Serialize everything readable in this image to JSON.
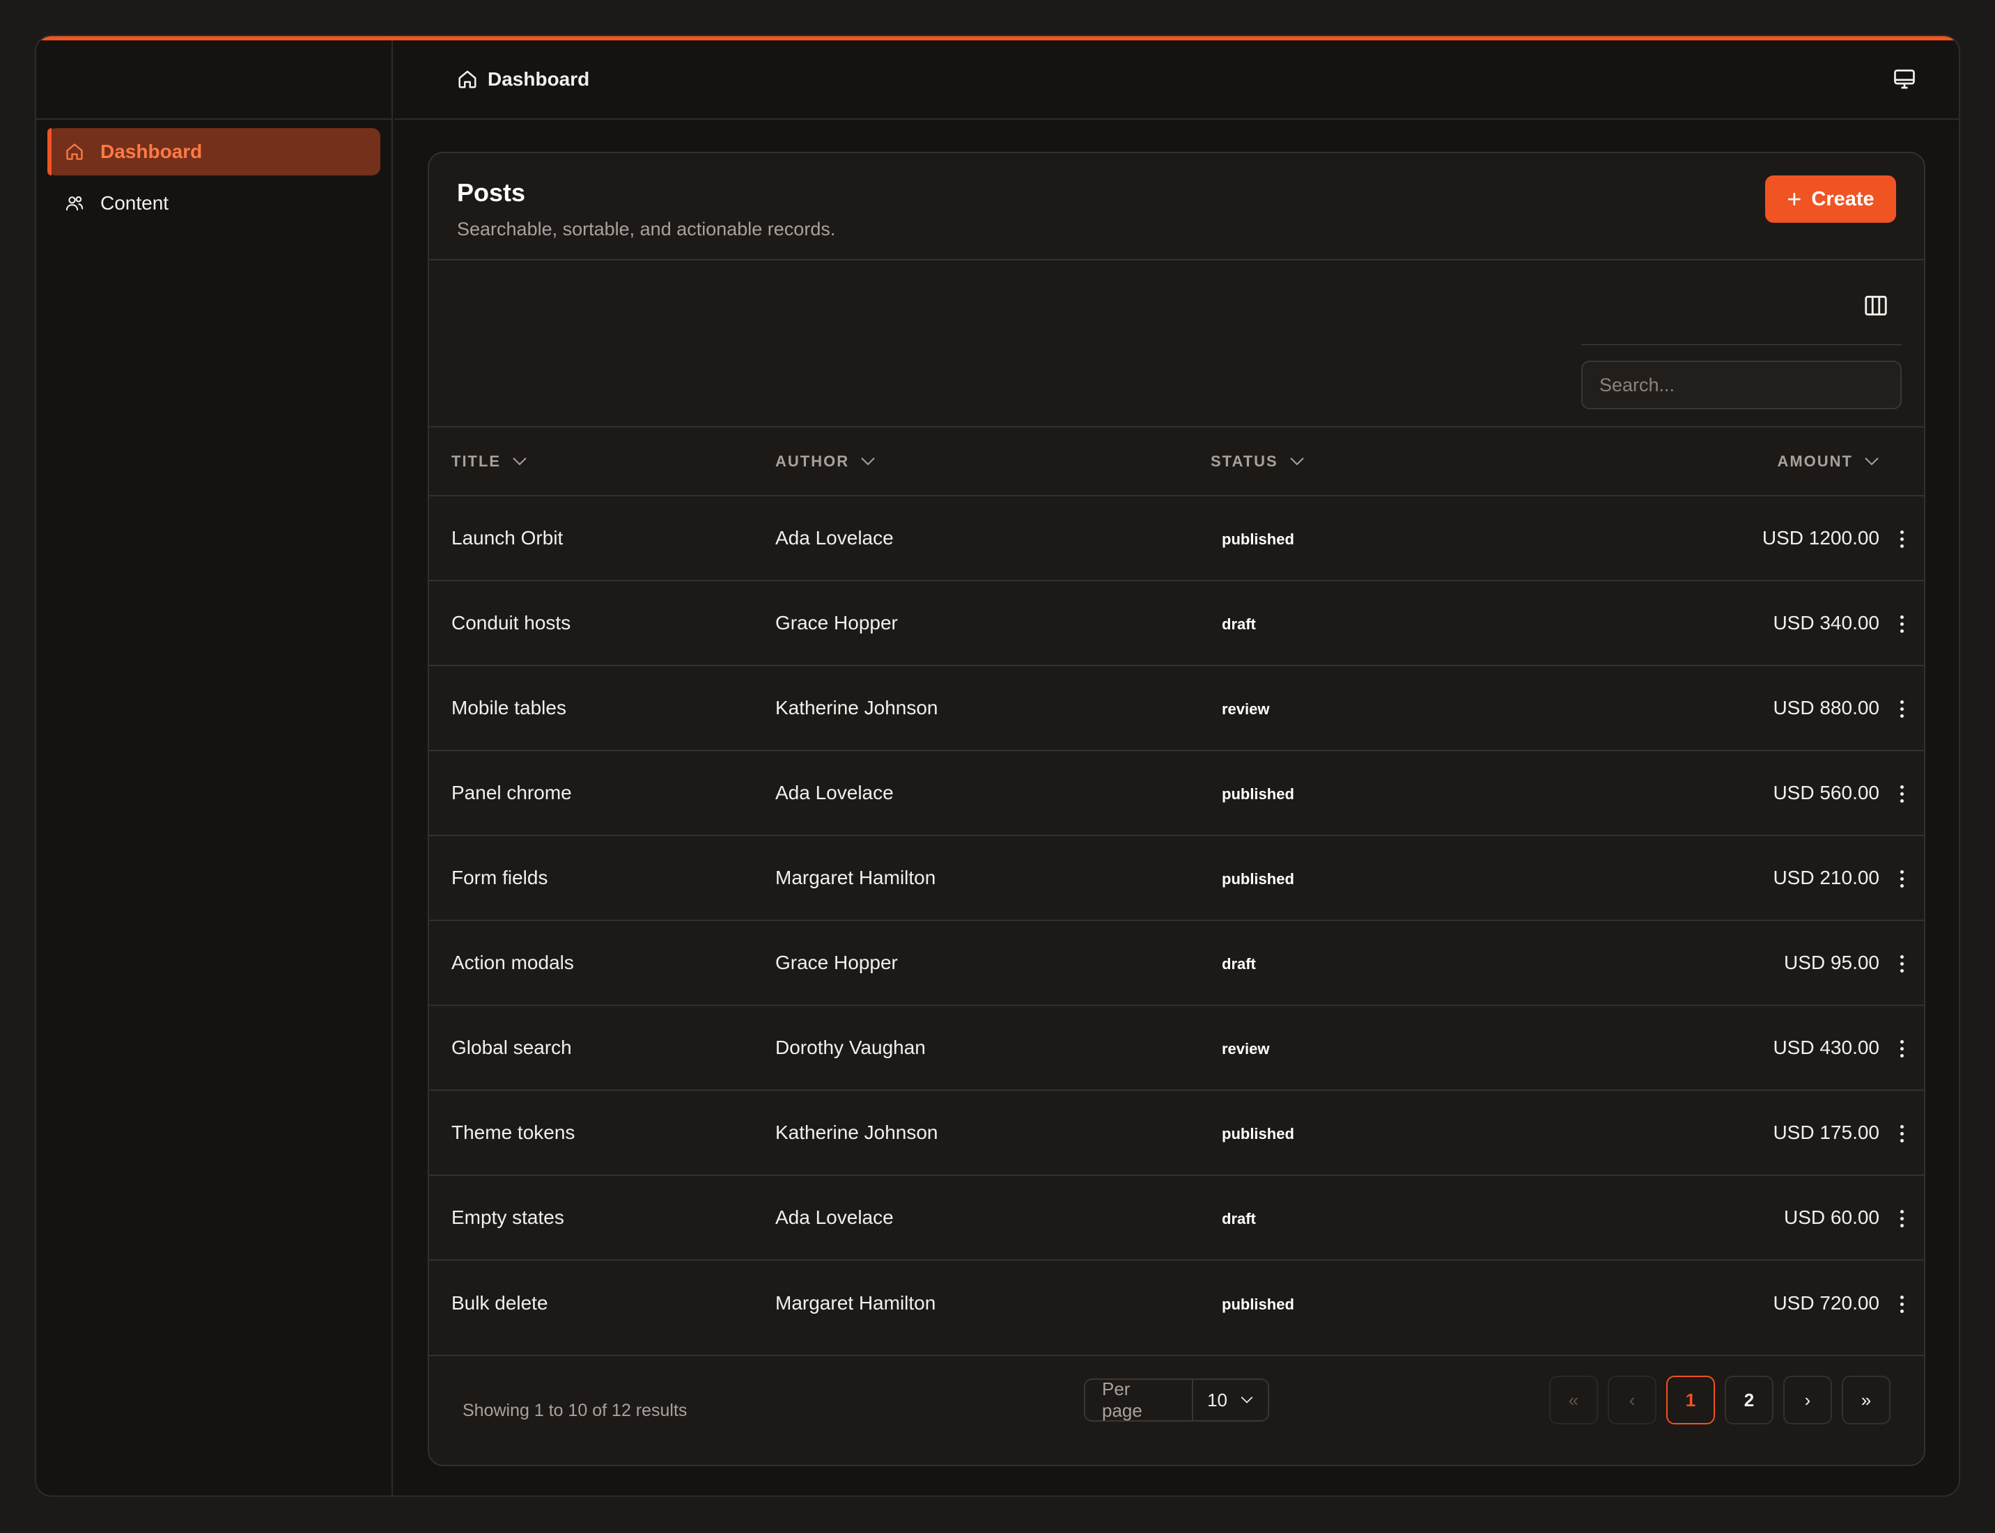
{
  "colors": {
    "accent": "#f05423",
    "background": "#151312",
    "card": "#1c1917",
    "border": "#33302d"
  },
  "sidebar": {
    "items": [
      {
        "label": "Dashboard",
        "icon": "home-icon",
        "active": true
      },
      {
        "label": "Content",
        "icon": "users-icon",
        "active": false
      }
    ]
  },
  "header": {
    "breadcrumb": "Dashboard",
    "monitor_icon": "monitor-icon"
  },
  "card": {
    "title": "Posts",
    "subtitle": "Searchable, sortable, and actionable records.",
    "create_label": "Create"
  },
  "search": {
    "placeholder": "Search..."
  },
  "table": {
    "headers": {
      "title": "TITLE",
      "author": "AUTHOR",
      "status": "STATUS",
      "amount": "AMOUNT"
    },
    "rows": [
      {
        "title": "Launch Orbit",
        "author": "Ada Lovelace",
        "status": "published",
        "amount": "USD 1200.00"
      },
      {
        "title": "Conduit hosts",
        "author": "Grace Hopper",
        "status": "draft",
        "amount": "USD 340.00"
      },
      {
        "title": "Mobile tables",
        "author": "Katherine Johnson",
        "status": "review",
        "amount": "USD 880.00"
      },
      {
        "title": "Panel chrome",
        "author": "Ada Lovelace",
        "status": "published",
        "amount": "USD 560.00"
      },
      {
        "title": "Form fields",
        "author": "Margaret Hamilton",
        "status": "published",
        "amount": "USD 210.00"
      },
      {
        "title": "Action modals",
        "author": "Grace Hopper",
        "status": "draft",
        "amount": "USD 95.00"
      },
      {
        "title": "Global search",
        "author": "Dorothy Vaughan",
        "status": "review",
        "amount": "USD 430.00"
      },
      {
        "title": "Theme tokens",
        "author": "Katherine Johnson",
        "status": "published",
        "amount": "USD 175.00"
      },
      {
        "title": "Empty states",
        "author": "Ada Lovelace",
        "status": "draft",
        "amount": "USD 60.00"
      },
      {
        "title": "Bulk delete",
        "author": "Margaret Hamilton",
        "status": "published",
        "amount": "USD 720.00"
      }
    ]
  },
  "footer": {
    "results": "Showing 1 to 10 of 12 results",
    "per_page_label": "Per page",
    "per_page_value": "10",
    "pager": {
      "first": "«",
      "prev": "‹",
      "pages": [
        "1",
        "2"
      ],
      "current": "1",
      "next": "›",
      "last": "»"
    }
  }
}
